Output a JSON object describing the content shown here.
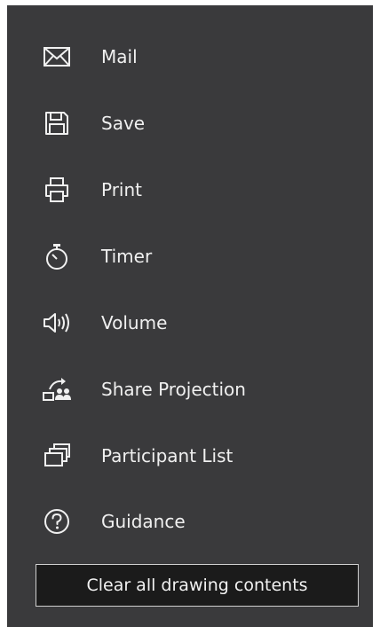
{
  "menu": {
    "items": [
      {
        "label": "Mail",
        "icon": "mail-icon"
      },
      {
        "label": "Save",
        "icon": "save-icon"
      },
      {
        "label": "Print",
        "icon": "print-icon"
      },
      {
        "label": "Timer",
        "icon": "timer-icon"
      },
      {
        "label": "Volume",
        "icon": "volume-icon"
      },
      {
        "label": "Share Projection",
        "icon": "share-projection-icon"
      },
      {
        "label": "Participant List",
        "icon": "participant-list-icon"
      },
      {
        "label": "Guidance",
        "icon": "guidance-icon"
      }
    ]
  },
  "clear_button": {
    "label": "Clear all drawing contents"
  },
  "colors": {
    "panel_background": "#3a3a3c",
    "text": "#f0f0f0",
    "button_background": "#1b1b1b",
    "button_border": "#cfcfcf"
  }
}
